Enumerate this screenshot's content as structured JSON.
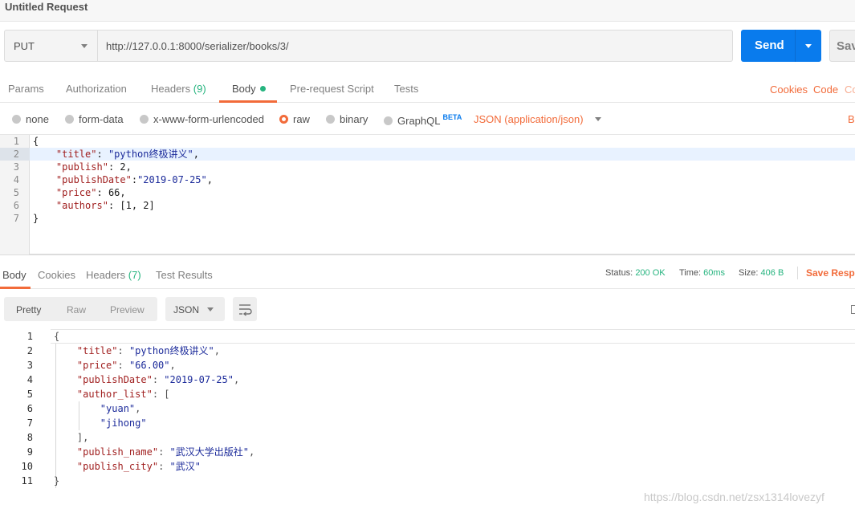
{
  "window": {
    "title": "Untitled Request"
  },
  "request": {
    "method": "PUT",
    "url": "http://127.0.0.1:8000/serializer/books/3/",
    "send_label": "Send",
    "save_label": "Sav"
  },
  "request_tabs": {
    "params": "Params",
    "authorization": "Authorization",
    "headers": "Headers",
    "headers_count": "(9)",
    "body": "Body",
    "pre_request": "Pre-request Script",
    "tests": "Tests",
    "cookies": "Cookies",
    "code": "Code",
    "comments_partial": "Co"
  },
  "body_types": {
    "none": "none",
    "form_data": "form-data",
    "urlencoded": "x-www-form-urlencoded",
    "raw": "raw",
    "binary": "binary",
    "graphql": "GraphQL",
    "beta": "BETA",
    "content_type": "JSON (application/json)",
    "edge_partial": "B",
    "selected": "raw"
  },
  "request_body": {
    "line_numbers": [
      "1",
      "2",
      "3",
      "4",
      "5",
      "6",
      "7"
    ],
    "lines": [
      {
        "pre": "{",
        "key": "",
        "mid": "",
        "val": "",
        "post": ""
      },
      {
        "pre": "    ",
        "key": "\"title\"",
        "mid": ": ",
        "val": "\"python终极讲义\"",
        "post": ","
      },
      {
        "pre": "    ",
        "key": "\"publish\"",
        "mid": ": ",
        "val": "2",
        "post": ","
      },
      {
        "pre": "    ",
        "key": "\"publishDate\"",
        "mid": ":",
        "val": "\"2019-07-25\"",
        "post": ","
      },
      {
        "pre": "    ",
        "key": "\"price\"",
        "mid": ": ",
        "val": "66",
        "post": ","
      },
      {
        "pre": "    ",
        "key": "\"authors\"",
        "mid": ": ",
        "val": "[1, 2]",
        "post": ""
      },
      {
        "pre": "}",
        "key": "",
        "mid": "",
        "val": "",
        "post": ""
      }
    ]
  },
  "response_tabs": {
    "body": "Body",
    "cookies": "Cookies",
    "headers": "Headers",
    "headers_count": "(7)",
    "test_results": "Test Results"
  },
  "response_status": {
    "status_label": "Status:",
    "status_value": "200 OK",
    "time_label": "Time:",
    "time_value": "60ms",
    "size_label": "Size:",
    "size_value": "406 B",
    "save_response": "Save Respo"
  },
  "response_toolbar": {
    "pretty": "Pretty",
    "raw": "Raw",
    "preview": "Preview",
    "format": "JSON"
  },
  "response_body": {
    "line_numbers": [
      "1",
      "2",
      "3",
      "4",
      "5",
      "6",
      "7",
      "8",
      "9",
      "10",
      "11"
    ],
    "lines": [
      {
        "pre": "{",
        "key": "",
        "mid": "",
        "val": "",
        "post": ""
      },
      {
        "pre": "    ",
        "key": "\"title\"",
        "mid": ": ",
        "val": "\"python终极讲义\"",
        "post": ","
      },
      {
        "pre": "    ",
        "key": "\"price\"",
        "mid": ": ",
        "val": "\"66.00\"",
        "post": ","
      },
      {
        "pre": "    ",
        "key": "\"publishDate\"",
        "mid": ": ",
        "val": "\"2019-07-25\"",
        "post": ","
      },
      {
        "pre": "    ",
        "key": "\"author_list\"",
        "mid": ": [",
        "val": "",
        "post": ""
      },
      {
        "pre": "        ",
        "key": "",
        "mid": "",
        "val": "\"yuan\"",
        "post": ","
      },
      {
        "pre": "        ",
        "key": "",
        "mid": "",
        "val": "\"jihong\"",
        "post": ""
      },
      {
        "pre": "    ],",
        "key": "",
        "mid": "",
        "val": "",
        "post": ""
      },
      {
        "pre": "    ",
        "key": "\"publish_name\"",
        "mid": ": ",
        "val": "\"武汉大学出版社\"",
        "post": ","
      },
      {
        "pre": "    ",
        "key": "\"publish_city\"",
        "mid": ": ",
        "val": "\"武汉\"",
        "post": ""
      },
      {
        "pre": "}",
        "key": "",
        "mid": "",
        "val": "",
        "post": ""
      }
    ]
  },
  "watermark": "https://blog.csdn.net/zsx1314lovezyf",
  "colors": {
    "accent_orange": "#f26b3a",
    "send_blue": "#097bed",
    "status_green": "#26b47f",
    "json_key": "#a01f1f",
    "json_string": "#1b2a9a"
  },
  "icons": {
    "method_dropdown": "chevron-down-icon",
    "send_dropdown": "chevron-down-icon",
    "wrap": "wrap-lines-icon"
  }
}
